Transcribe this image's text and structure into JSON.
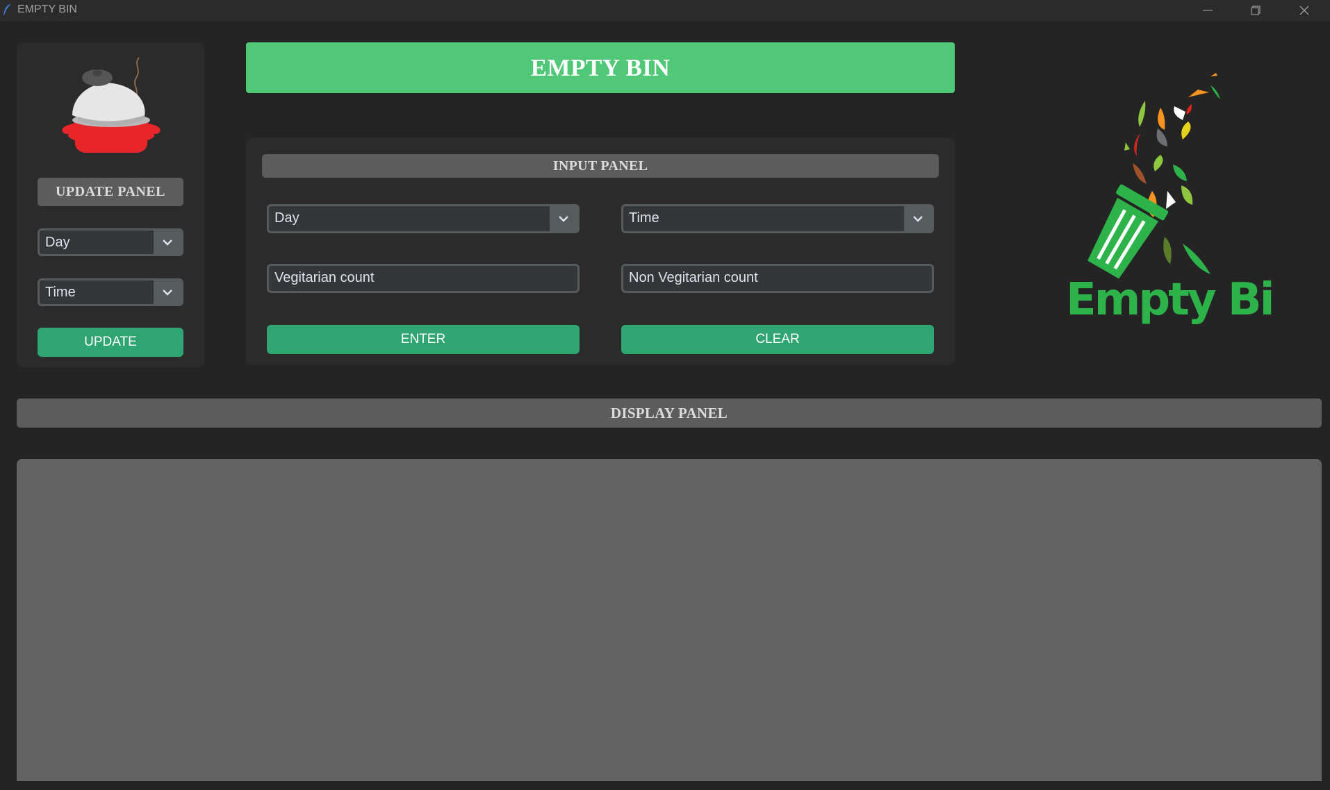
{
  "window": {
    "title": "EMPTY BIN",
    "app_icon": "feather-icon",
    "controls": [
      "minimize-icon",
      "maximize-icon",
      "close-icon"
    ]
  },
  "banner": {
    "title": "EMPTY BIN"
  },
  "update_panel": {
    "header": "UPDATE PANEL",
    "image": "cooking-pot-icon",
    "day_select": {
      "value": "Day"
    },
    "time_select": {
      "value": "Time"
    },
    "button_label": "UPDATE"
  },
  "input_panel": {
    "header": "INPUT PANEL",
    "day_select": {
      "value": "Day"
    },
    "time_select": {
      "value": "Time"
    },
    "veg_count": {
      "value": "Vegitarian count"
    },
    "nonveg_count": {
      "value": "Non Vegitarian count"
    },
    "enter_label": "ENTER",
    "clear_label": "CLEAR"
  },
  "logo": {
    "text": "Empty Bin"
  },
  "display_panel": {
    "header": "DISPLAY PANEL"
  },
  "colors": {
    "background": "#242424",
    "card": "#2b2b2b",
    "accent_button": "#2fa572",
    "banner": "#51c878",
    "header": "#5c5c5c",
    "display_area": "#626262"
  }
}
